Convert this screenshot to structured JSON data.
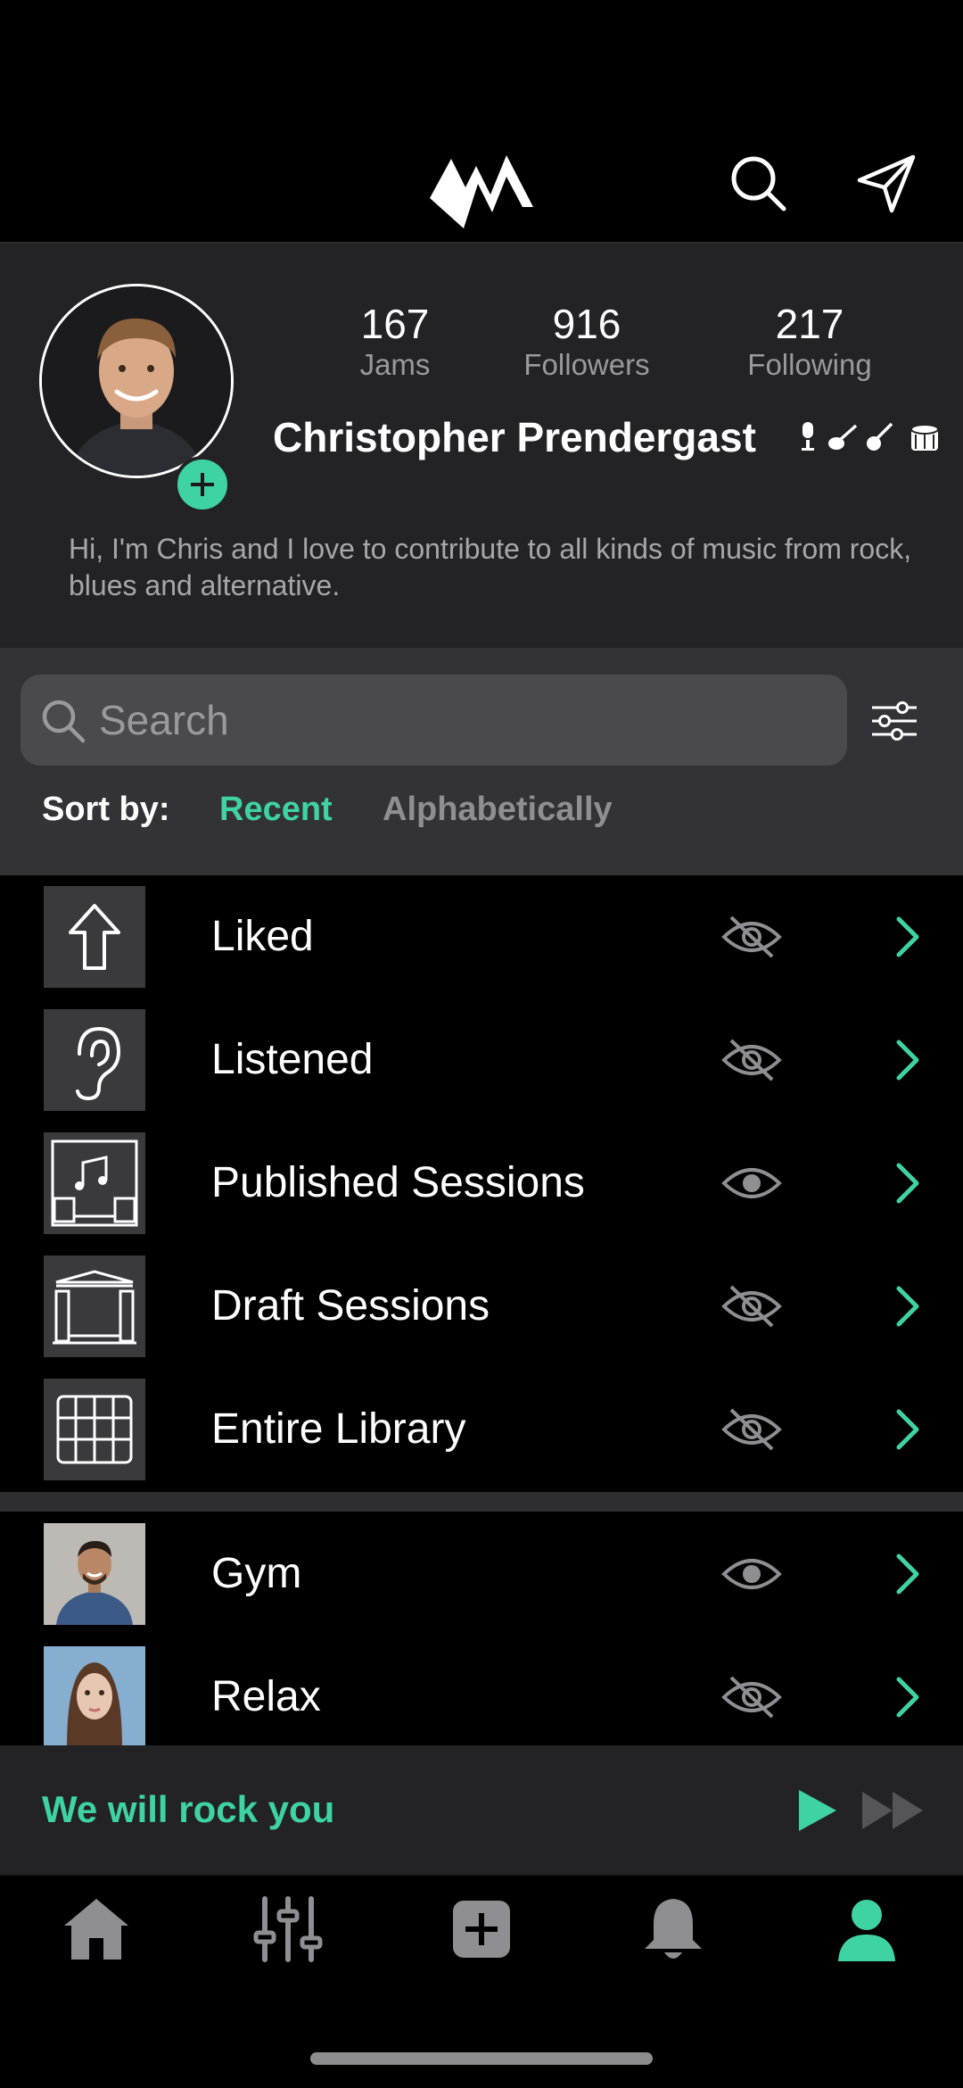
{
  "profile": {
    "stats": [
      {
        "value": "167",
        "label": "Jams"
      },
      {
        "value": "916",
        "label": "Followers"
      },
      {
        "value": "217",
        "label": "Following"
      }
    ],
    "name": "Christopher Prendergast",
    "bio": "Hi, I'm Chris and I love to contribute to all kinds of music from rock, blues and alternative."
  },
  "search": {
    "placeholder": "Search"
  },
  "sort": {
    "label": "Sort by:",
    "options": [
      "Recent",
      "Alphabetically"
    ],
    "selected": "Recent"
  },
  "library": {
    "items": [
      {
        "label": "Liked",
        "icon": "arrow-up-icon",
        "visibility": "hidden"
      },
      {
        "label": "Listened",
        "icon": "ear-icon",
        "visibility": "hidden"
      },
      {
        "label": "Published Sessions",
        "icon": "stage-speakers-icon",
        "visibility": "visible"
      },
      {
        "label": "Draft Sessions",
        "icon": "stage-icon",
        "visibility": "hidden"
      },
      {
        "label": "Entire Library",
        "icon": "library-grid-icon",
        "visibility": "hidden"
      }
    ],
    "playlists": [
      {
        "label": "Gym",
        "visibility": "visible"
      },
      {
        "label": "Relax",
        "visibility": "hidden"
      }
    ]
  },
  "player": {
    "track": "We will rock you"
  },
  "tabs": [
    "home-icon",
    "mixer-icon",
    "add-icon",
    "bell-icon",
    "profile-icon"
  ],
  "colors": {
    "accent": "#3fd3a3",
    "background": "#000000",
    "panel": "#232325",
    "search_panel": "#333337"
  }
}
